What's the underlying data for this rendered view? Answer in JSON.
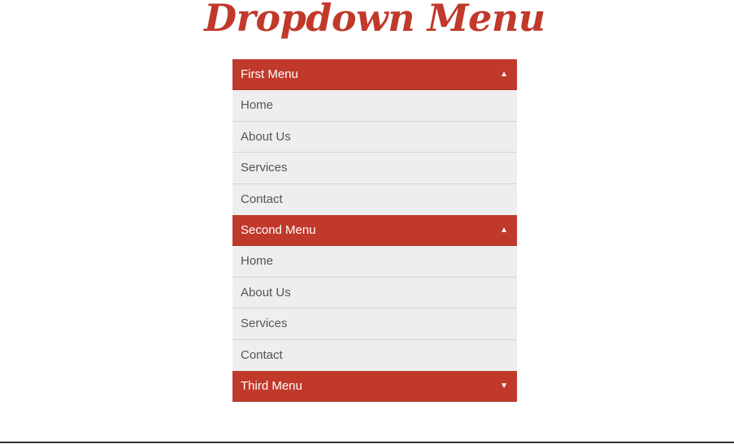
{
  "page": {
    "title": "Dropdown Menu"
  },
  "colors": {
    "accent": "#c0392b",
    "item_background": "#eeeeee",
    "item_text": "#555555"
  },
  "menus": [
    {
      "label": "First Menu",
      "expanded": true,
      "arrow_icon": "triangle-up-icon",
      "arrow_glyph": "▲",
      "items": [
        {
          "label": "Home"
        },
        {
          "label": "About Us"
        },
        {
          "label": "Services"
        },
        {
          "label": "Contact"
        }
      ]
    },
    {
      "label": "Second Menu",
      "expanded": true,
      "arrow_icon": "triangle-up-icon",
      "arrow_glyph": "▲",
      "items": [
        {
          "label": "Home"
        },
        {
          "label": "About Us"
        },
        {
          "label": "Services"
        },
        {
          "label": "Contact"
        }
      ]
    },
    {
      "label": "Third Menu",
      "expanded": false,
      "arrow_icon": "triangle-down-icon",
      "arrow_glyph": "▼",
      "items": []
    }
  ]
}
